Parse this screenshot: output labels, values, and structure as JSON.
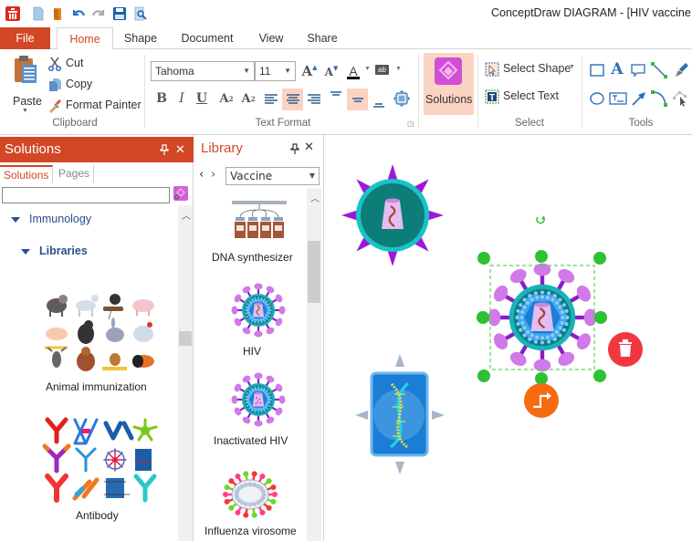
{
  "window": {
    "title": "ConceptDraw DIAGRAM - [HIV vaccine de"
  },
  "quick_access": [
    {
      "name": "app-logo-icon"
    },
    {
      "name": "new-document-icon"
    },
    {
      "name": "open-folder-icon"
    },
    {
      "name": "undo-icon"
    },
    {
      "name": "redo-icon"
    },
    {
      "name": "save-icon"
    },
    {
      "name": "print-preview-icon"
    }
  ],
  "menu_tabs": {
    "file": "File",
    "items": [
      "Home",
      "Shape",
      "Document",
      "View",
      "Share"
    ],
    "active": "Home"
  },
  "ribbon": {
    "clipboard": {
      "paste": "Paste",
      "cut": "Cut",
      "copy": "Copy",
      "format_painter": "Format Painter",
      "label": "Clipboard"
    },
    "text_format": {
      "font": "Tahoma",
      "size": "11",
      "bold": "B",
      "italic": "I",
      "underline": "U",
      "label": "Text Format",
      "font_color_glyph": "A",
      "grow_glyph": "A",
      "shrink_glyph": "A",
      "superscript_glyph": "A",
      "subscript_glyph": "A",
      "highlight_glyph": "ab"
    },
    "solutions": {
      "label": "Solutions"
    },
    "select": {
      "select_shape": "Select Shape",
      "select_text": "Select Text",
      "label": "Select"
    },
    "tools": {
      "label": "Tools",
      "text_glyph": "A"
    },
    "accent": "#d24726",
    "active_highlight": "#fbd3c2"
  },
  "solutions_panel": {
    "title": "Solutions",
    "pin": "1",
    "close": "✕",
    "tabs": [
      "Solutions",
      "Pages"
    ],
    "active_tab": "Solutions",
    "search_value": "",
    "tree": [
      {
        "label": "Immunology",
        "level": 0,
        "expanded": true
      },
      {
        "label": "Libraries",
        "level": 1,
        "expanded": true
      }
    ],
    "libraries": [
      {
        "caption": "Animal immunization"
      },
      {
        "caption": "Antibody"
      }
    ]
  },
  "library_panel": {
    "title": "Library",
    "close": "✕",
    "selected_library": "Vaccine",
    "items": [
      {
        "caption": "DNA synthesizer"
      },
      {
        "caption": "HIV"
      },
      {
        "caption": "Inactivated HIV"
      },
      {
        "caption": "Influenza virosome"
      }
    ]
  },
  "canvas": {
    "shapes": [
      {
        "name": "virus-core-shape",
        "selected": false
      },
      {
        "name": "hiv-shape",
        "selected": true
      },
      {
        "name": "dna-card-shape",
        "selected": false
      }
    ],
    "colors": {
      "selection_handle": "#2ec233",
      "delete_button": "#f2363f",
      "connector_button": "#f86a10"
    }
  }
}
